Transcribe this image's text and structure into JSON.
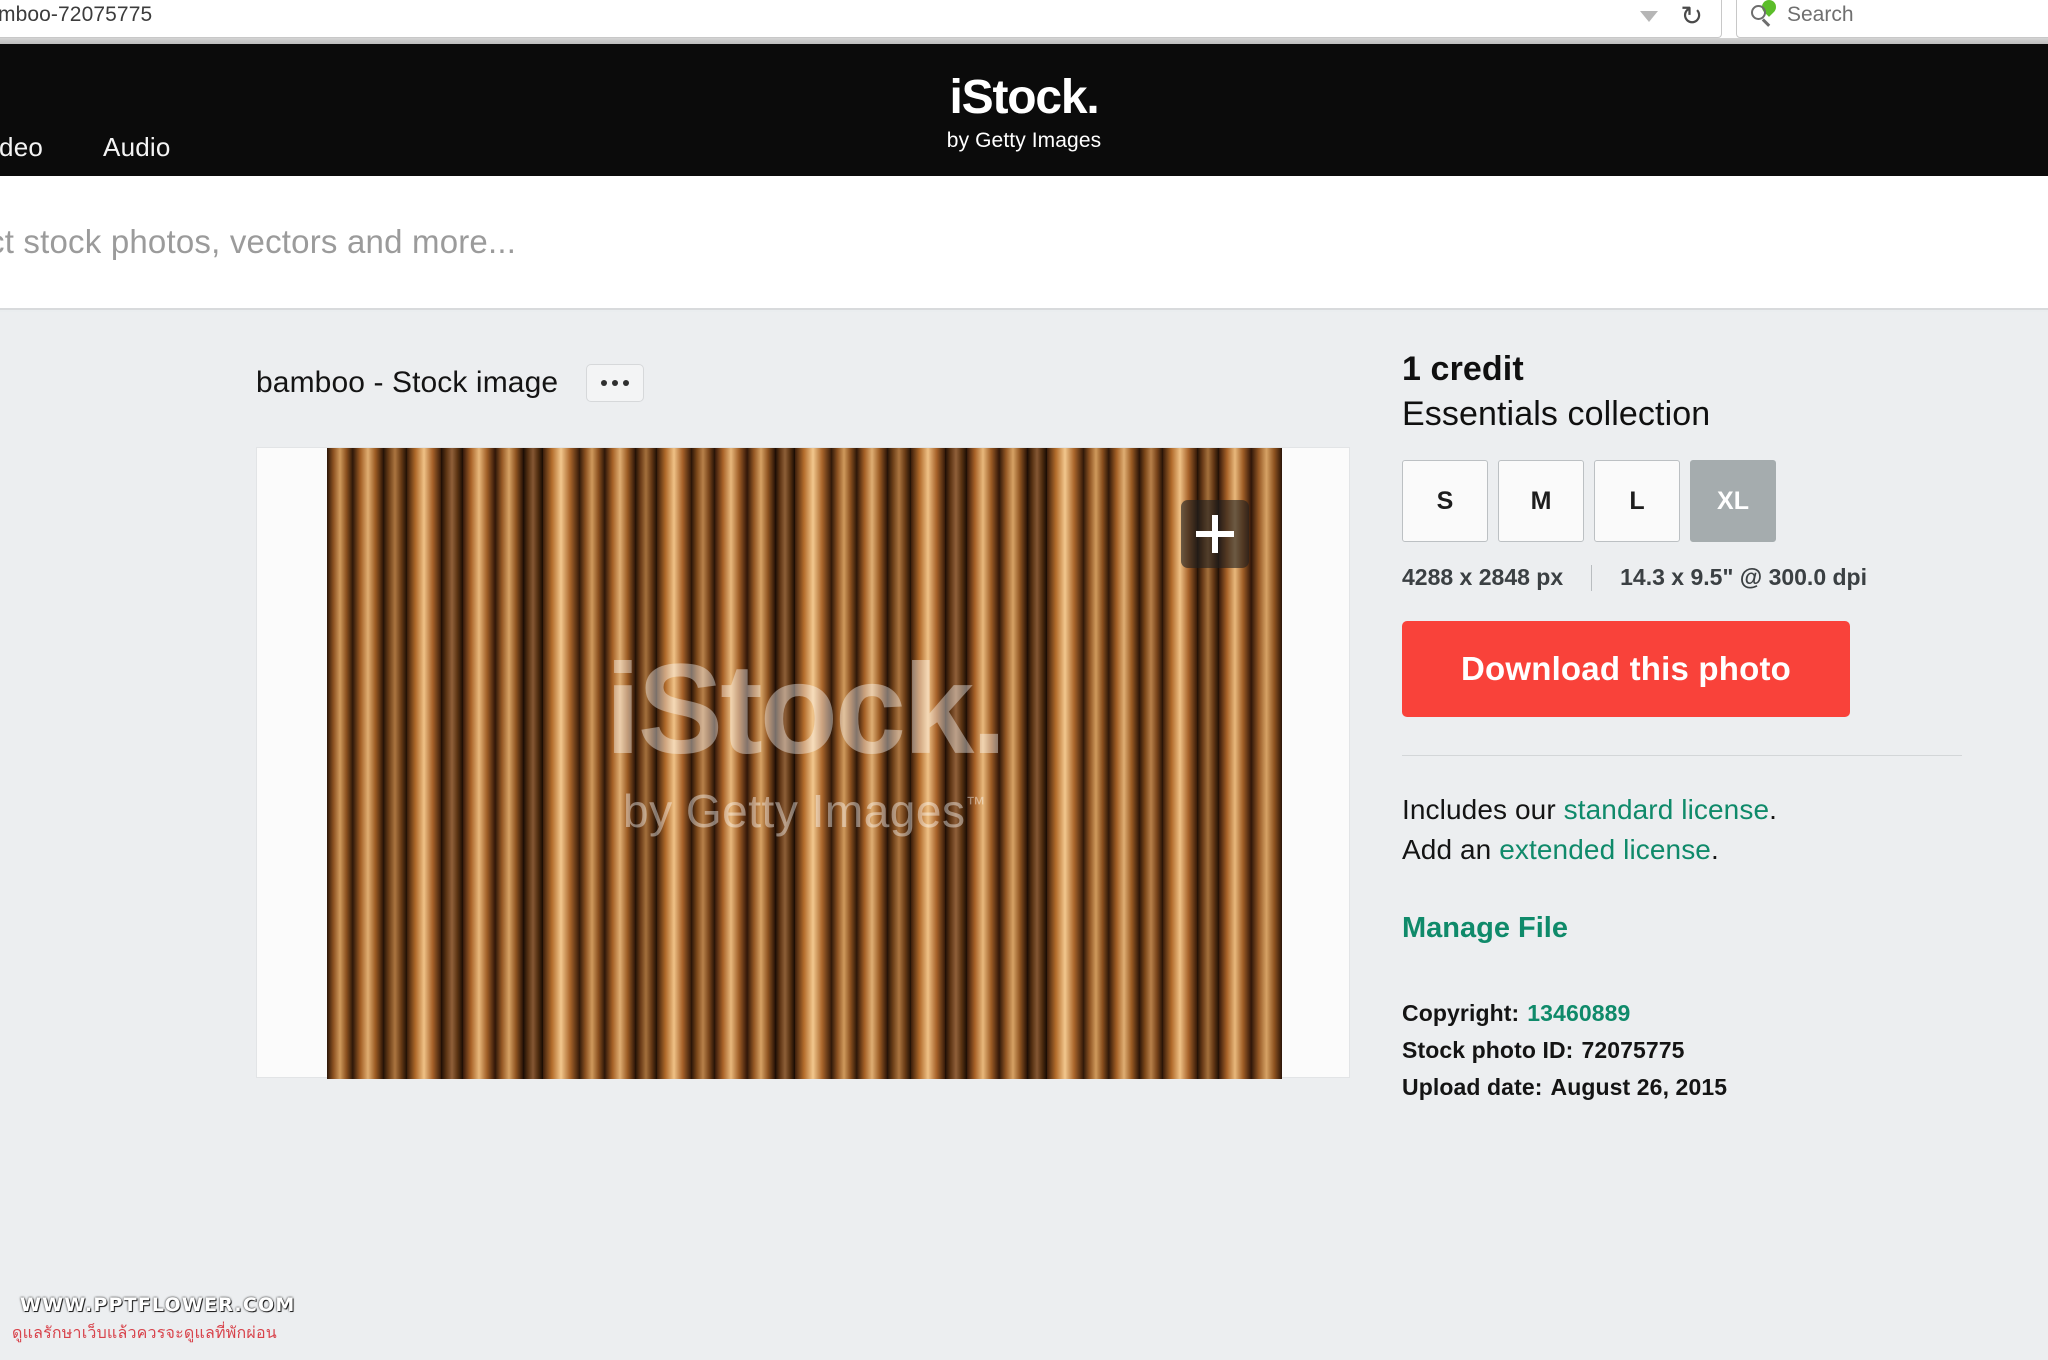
{
  "browser": {
    "url_text": "mboo-72075775",
    "reload_icon": "reload-icon",
    "dropdown_icon": "chevron-down-icon",
    "search_icon": "search-icon",
    "search_placeholder": "Search"
  },
  "header": {
    "nav": [
      {
        "label": "Video"
      },
      {
        "label": "Audio"
      }
    ],
    "logo_main": "iStock.",
    "logo_sub": "by Getty Images"
  },
  "search_bar": {
    "placeholder": "ct stock photos, vectors and more..."
  },
  "main": {
    "title": "bamboo - Stock image",
    "more_button_label": "...",
    "image": {
      "watermark_main": "iStock.",
      "watermark_sub": "by Getty Images",
      "watermark_tm": "™",
      "zoom_icon": "plus-icon",
      "alt": "bamboo"
    }
  },
  "rail": {
    "credit": "1 credit",
    "collection": "Essentials collection",
    "sizes": [
      {
        "label": "S",
        "selected": false
      },
      {
        "label": "M",
        "selected": false
      },
      {
        "label": "L",
        "selected": false
      },
      {
        "label": "XL",
        "selected": true
      }
    ],
    "dimensions_px": "4288 x 2848 px",
    "dimensions_in": "14.3 x 9.5\" @ 300.0 dpi",
    "download_label": "Download this photo",
    "license": {
      "includes_prefix": "Includes our ",
      "standard_link": "standard license",
      "includes_suffix": ".",
      "add_prefix": "Add an ",
      "extended_link": "extended license",
      "add_suffix": "."
    },
    "manage_file": "Manage File",
    "meta": [
      {
        "label": "Copyright:",
        "value": "13460889",
        "is_link": true
      },
      {
        "label": "Stock photo ID:",
        "value": "72075775",
        "is_link": false
      },
      {
        "label": "Upload date:",
        "value": "August 26, 2015",
        "is_link": false
      }
    ]
  },
  "watermark": {
    "url": "WWW.PPTFLOWER.COM",
    "thai": "ดูแลรักษาเว็บแล้วควรจะดูแลที่พักผ่อน"
  },
  "colors": {
    "accent_red": "#f9423a",
    "accent_teal": "#0f8a6a",
    "header_black": "#0b0b0b",
    "page_bg": "#eceef0",
    "selected_size": "#a5acae"
  }
}
